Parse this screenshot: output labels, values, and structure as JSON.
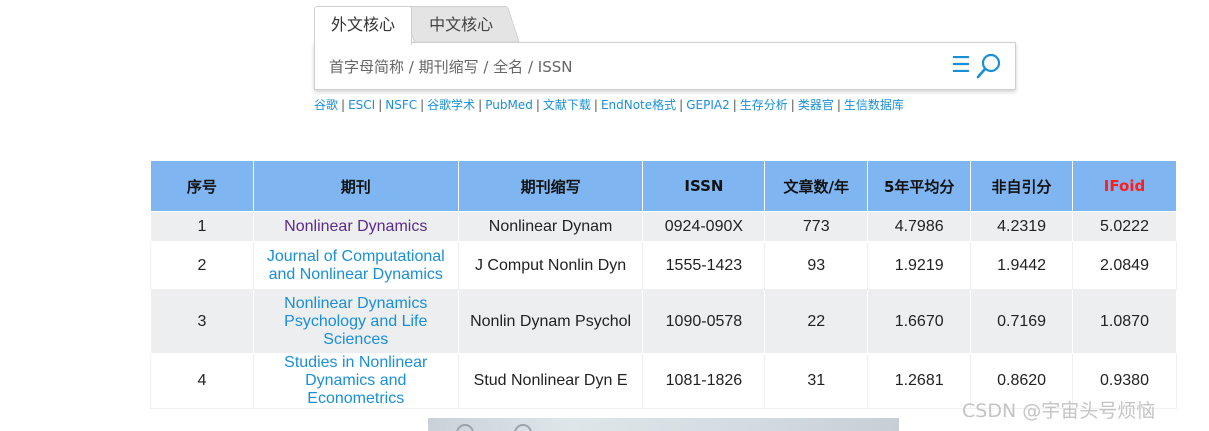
{
  "tabs": [
    {
      "label": "外文核心",
      "active": true
    },
    {
      "label": "中文核心",
      "active": false
    }
  ],
  "search": {
    "placeholder": "首字母简称 / 期刊缩写 / 全名 / ISSN",
    "value": "",
    "menu_icon": "menu-icon",
    "search_icon": "search-icon"
  },
  "links": [
    "谷歌",
    "ESCI",
    "NSFC",
    "谷歌学术",
    "PubMed",
    "文献下载",
    "EndNote格式",
    "GEPIA2",
    "生存分析",
    "类器官",
    "生信数据库"
  ],
  "table": {
    "headers": [
      "序号",
      "期刊",
      "期刊缩写",
      "ISSN",
      "文章数/年",
      "5年平均分",
      "非自引分",
      "IFoid"
    ],
    "header_highlight_color": "#ff1c1c",
    "rows": [
      {
        "no": "1",
        "journal": "Nonlinear Dynamics",
        "abbr": "Nonlinear Dynam",
        "issn": "0924-090X",
        "articles": "773",
        "avg5": "4.7986",
        "nonself": "4.2319",
        "if": "5.0222"
      },
      {
        "no": "2",
        "journal": "Journal of Computational and Nonlinear Dynamics",
        "abbr": "J Comput Nonlin Dyn",
        "issn": "1555-1423",
        "articles": "93",
        "avg5": "1.9219",
        "nonself": "1.9442",
        "if": "2.0849"
      },
      {
        "no": "3",
        "journal": "Nonlinear Dynamics Psychology and Life Sciences",
        "abbr": "Nonlin Dynam Psychol",
        "issn": "1090-0578",
        "articles": "22",
        "avg5": "1.6670",
        "nonself": "0.7169",
        "if": "1.0870"
      },
      {
        "no": "4",
        "journal": "Studies in Nonlinear Dynamics and Econometrics",
        "abbr": "Stud Nonlinear Dyn E",
        "issn": "1081-1826",
        "articles": "31",
        "avg5": "1.2681",
        "nonself": "0.8620",
        "if": "0.9380"
      }
    ]
  },
  "watermark": "CSDN @宇宙头号烦恼",
  "colors": {
    "link": "#1a8fd8",
    "visited": "#5c2b8a",
    "header_bg": "#7fb6f2"
  }
}
